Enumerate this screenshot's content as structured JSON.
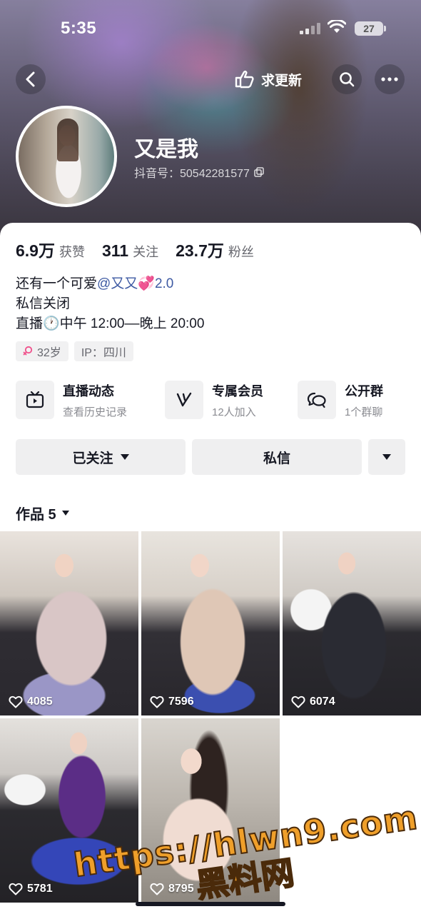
{
  "status_bar": {
    "time": "5:35",
    "battery": "27"
  },
  "header": {
    "update_label": "求更新"
  },
  "profile": {
    "name": "又是我",
    "account_id": "抖音号：50542281577"
  },
  "stats": [
    {
      "value": "6.9万",
      "label": "获赞"
    },
    {
      "value": "311",
      "label": "关注"
    },
    {
      "value": "23.7万",
      "label": "粉丝"
    }
  ],
  "bio": {
    "line1_prefix": "还有一个可爱",
    "line1_mention": "@又又💞2.0",
    "line2": "私信关闭",
    "line3": "直播🕐中午 12:00––晚上 20:00"
  },
  "tags": [
    {
      "icon": "female-icon",
      "label": "32岁"
    },
    {
      "label": "IP：四川"
    }
  ],
  "features": [
    {
      "icon": "tv-icon",
      "title": "直播动态",
      "subtitle": "查看历史记录"
    },
    {
      "icon": "v-icon",
      "title": "专属会员",
      "subtitle": "12人加入"
    },
    {
      "icon": "chat-icon",
      "title": "公开群",
      "subtitle": "1个群聊"
    }
  ],
  "actions": {
    "follow": "已关注",
    "message": "私信"
  },
  "works": {
    "label": "作品 5"
  },
  "videos": [
    {
      "likes": "4085"
    },
    {
      "likes": "7596"
    },
    {
      "likes": "6074"
    },
    {
      "likes": "5781"
    },
    {
      "likes": "8795"
    }
  ],
  "watermark": {
    "url": "https://hlwn9.com",
    "text": "黑料网"
  },
  "colors": {
    "mention": "#3e5aa3",
    "button_bg": "#efeff0",
    "watermark": "#ef9f2a"
  }
}
